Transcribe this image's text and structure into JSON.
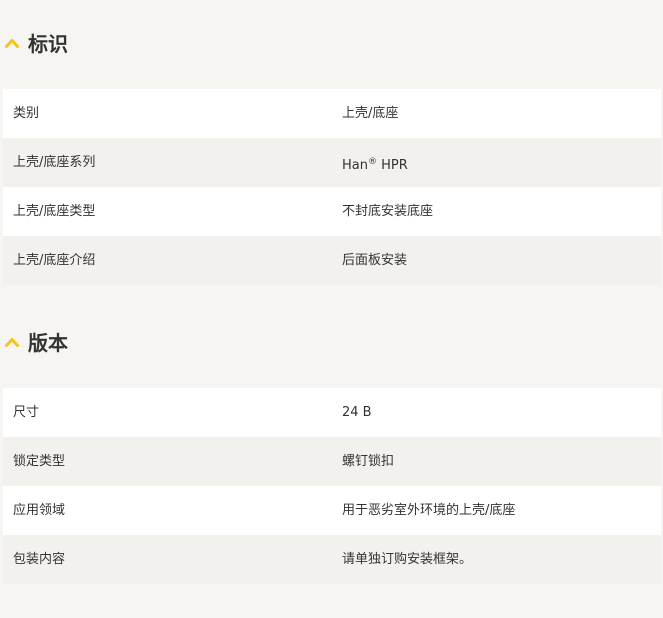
{
  "colors": {
    "accent": "#f5c518",
    "text": "#333333",
    "background": "#f6f5f2",
    "row_light": "#ffffff",
    "row_shaded": "#f2f1ee"
  },
  "sections": [
    {
      "title": "标识",
      "icon": "chevron-up-icon",
      "rows": [
        {
          "label": "类别",
          "value": "上壳/底座"
        },
        {
          "label": "上壳/底座系列",
          "value": "Han",
          "value_sup": "®",
          "value_suffix": " HPR"
        },
        {
          "label": "上壳/底座类型",
          "value": "不封底安装底座"
        },
        {
          "label": "上壳/底座介绍",
          "value": "后面板安装"
        }
      ]
    },
    {
      "title": "版本",
      "icon": "chevron-up-icon",
      "rows": [
        {
          "label": "尺寸",
          "value": "24 B"
        },
        {
          "label": "锁定类型",
          "value": "螺钉锁扣"
        },
        {
          "label": "应用领域",
          "value": "用于恶劣室外环境的上壳/底座"
        },
        {
          "label": "包装内容",
          "value": "请单独订购安装框架。"
        }
      ]
    }
  ]
}
